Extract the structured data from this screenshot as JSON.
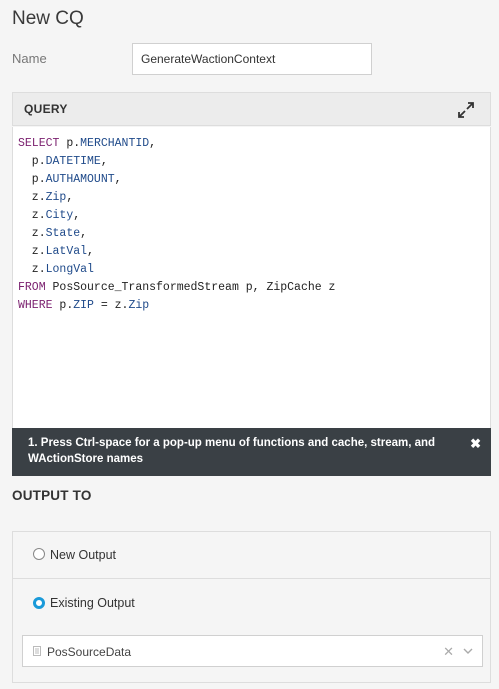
{
  "header": {
    "title": "New CQ"
  },
  "name_field": {
    "label": "Name",
    "value": "GenerateWactionContext"
  },
  "query": {
    "title": "QUERY",
    "lines": [
      [
        {
          "t": "SELECT",
          "c": "kw"
        },
        {
          "t": " p.",
          "c": ""
        },
        {
          "t": "MERCHANTID",
          "c": "fld"
        },
        {
          "t": ",",
          "c": ""
        }
      ],
      [
        {
          "t": "  p.",
          "c": ""
        },
        {
          "t": "DATETIME",
          "c": "fld"
        },
        {
          "t": ",",
          "c": ""
        }
      ],
      [
        {
          "t": "  p.",
          "c": ""
        },
        {
          "t": "AUTHAMOUNT",
          "c": "fld"
        },
        {
          "t": ",",
          "c": ""
        }
      ],
      [
        {
          "t": "  z.",
          "c": ""
        },
        {
          "t": "Zip",
          "c": "fld"
        },
        {
          "t": ",",
          "c": ""
        }
      ],
      [
        {
          "t": "  z.",
          "c": ""
        },
        {
          "t": "City",
          "c": "fld"
        },
        {
          "t": ",",
          "c": ""
        }
      ],
      [
        {
          "t": "  z.",
          "c": ""
        },
        {
          "t": "State",
          "c": "fld"
        },
        {
          "t": ",",
          "c": ""
        }
      ],
      [
        {
          "t": "  z.",
          "c": ""
        },
        {
          "t": "LatVal",
          "c": "fld"
        },
        {
          "t": ",",
          "c": ""
        }
      ],
      [
        {
          "t": "  z.",
          "c": ""
        },
        {
          "t": "LongVal",
          "c": "fld"
        }
      ],
      [
        {
          "t": "FROM",
          "c": "kw"
        },
        {
          "t": " PosSource_TransformedStream p, ZipCache z",
          "c": ""
        }
      ],
      [
        {
          "t": "WHERE",
          "c": "kw"
        },
        {
          "t": " p.",
          "c": ""
        },
        {
          "t": "ZIP",
          "c": "fld"
        },
        {
          "t": " = z.",
          "c": ""
        },
        {
          "t": "Zip",
          "c": "fld"
        }
      ]
    ],
    "tip": "1. Press Ctrl-space for a pop-up menu of functions and cache, stream, and WActionStore names"
  },
  "output": {
    "title": "OUTPUT TO",
    "new_output_label": "New Output",
    "existing_output_label": "Existing Output",
    "selected": "existing",
    "selected_value": "PosSourceData"
  },
  "colors": {
    "keyword": "#7a1f6e",
    "field": "#1f4a8a",
    "accent": "#1a9ad9",
    "tip_bg": "#3a4045"
  },
  "icons": {
    "expand": "expand-icon",
    "close_tip": "close-icon",
    "clear": "clear-icon",
    "chevron": "chevron-down-icon",
    "doc": "document-icon"
  }
}
